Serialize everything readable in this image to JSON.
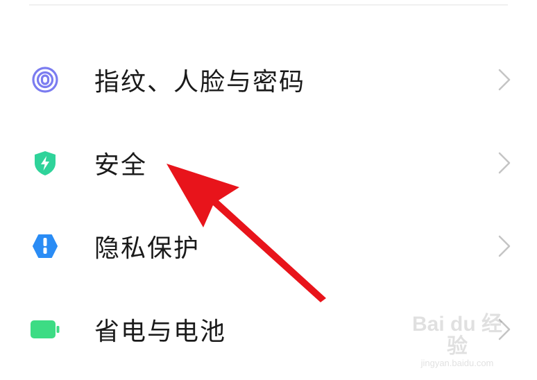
{
  "settings": {
    "items": [
      {
        "label": "指纹、人脸与密码",
        "icon": "fingerprint-icon",
        "icon_color": "#7b7cf0"
      },
      {
        "label": "安全",
        "icon": "shield-icon",
        "icon_color": "#2fd39a"
      },
      {
        "label": "隐私保护",
        "icon": "privacy-icon",
        "icon_color": "#2a8cf5"
      },
      {
        "label": "省电与电池",
        "icon": "battery-icon",
        "icon_color": "#3ddc84"
      }
    ]
  },
  "annotation": {
    "arrow_color": "#e8141b",
    "arrow_target": "安全"
  },
  "watermark": {
    "logo": "Bai du 经验",
    "url": "jingyan.baidu.com"
  }
}
